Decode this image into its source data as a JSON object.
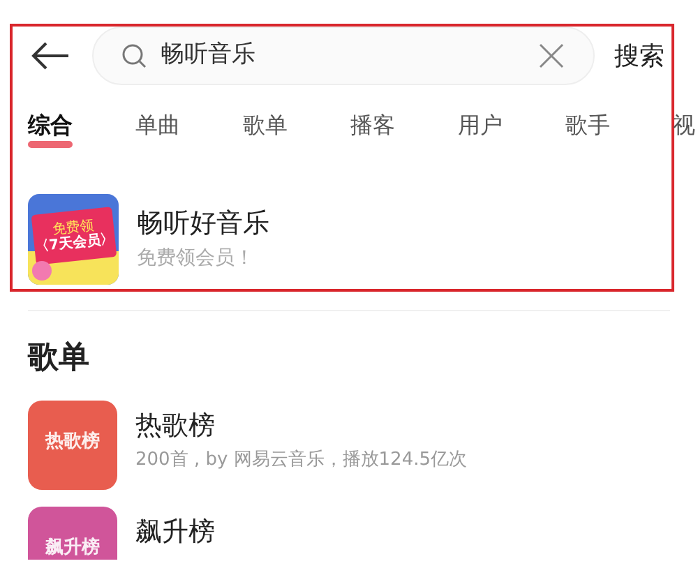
{
  "search": {
    "value": "畅听音乐",
    "action": "搜索"
  },
  "tabs": [
    {
      "label": "综合",
      "selected": true
    },
    {
      "label": "单曲",
      "selected": false
    },
    {
      "label": "歌单",
      "selected": false
    },
    {
      "label": "播客",
      "selected": false
    },
    {
      "label": "用户",
      "selected": false
    },
    {
      "label": "歌手",
      "selected": false
    },
    {
      "label": "视",
      "selected": false
    }
  ],
  "promo": {
    "badge_top": "免费领",
    "badge_main": "〈7天会员〉",
    "title": "畅听好音乐",
    "subtitle": "免费领会员！"
  },
  "section": {
    "title": "歌单"
  },
  "playlists": [
    {
      "cover_label": "热歌榜",
      "title": "热歌榜",
      "subtitle": "200首 , by 网易云音乐，播放124.5亿次",
      "color": "#e85d4f"
    },
    {
      "cover_label": "飙升榜",
      "title": "飙升榜",
      "color": "#d0559a"
    }
  ]
}
